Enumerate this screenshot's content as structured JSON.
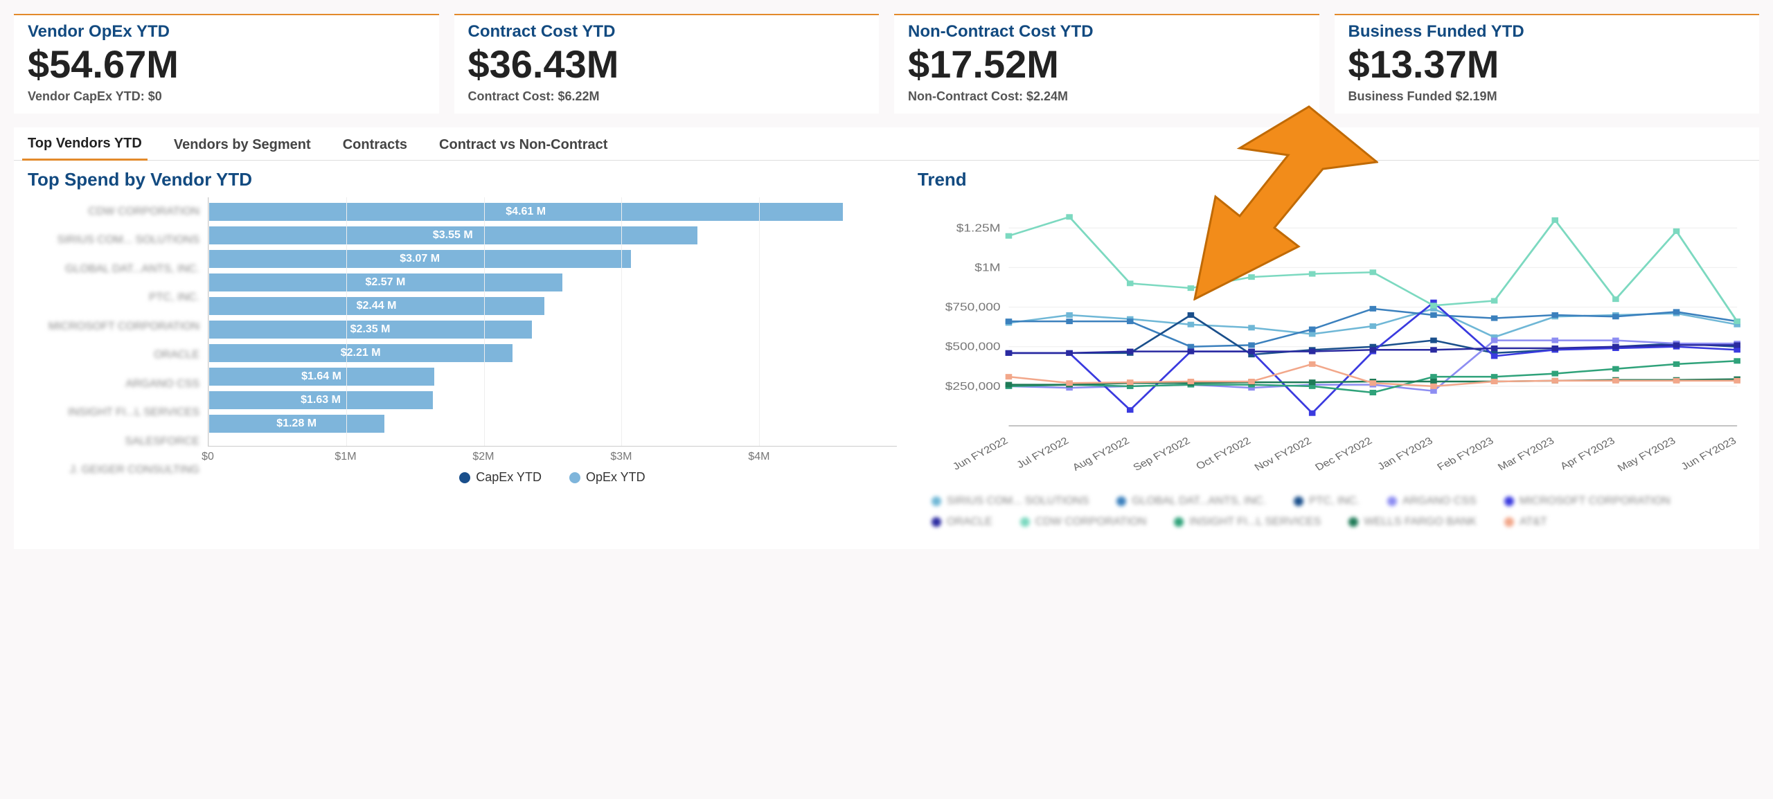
{
  "kpis": [
    {
      "title": "Vendor OpEx YTD",
      "value": "$54.67M",
      "sub": "Vendor CapEx YTD: $0"
    },
    {
      "title": "Contract Cost YTD",
      "value": "$36.43M",
      "sub": "Contract Cost: $6.22M"
    },
    {
      "title": "Non-Contract Cost YTD",
      "value": "$17.52M",
      "sub": "Non-Contract Cost: $2.24M"
    },
    {
      "title": "Business Funded YTD",
      "value": "$13.37M",
      "sub": "Business Funded $2.19M"
    }
  ],
  "tabs": [
    "Top Vendors YTD",
    "Vendors by Segment",
    "Contracts",
    "Contract vs Non-Contract"
  ],
  "active_tab": 0,
  "bar_chart_title": "Top Spend by Vendor YTD",
  "trend_title": "Trend",
  "bar_legend": {
    "capex": "CapEx YTD",
    "opex": "OpEx YTD"
  },
  "colors": {
    "opex_bar": "#7eb5db",
    "capex_dot": "#1a4f8b",
    "accent": "#e38a2b",
    "arrow": "#f28c1a"
  },
  "chart_data": [
    {
      "id": "top_spend_by_vendor",
      "type": "bar",
      "orientation": "horizontal",
      "title": "Top Spend by Vendor YTD",
      "xlabel": "",
      "ylabel": "",
      "xlim": [
        0,
        5
      ],
      "x_ticks": [
        "$0",
        "$1M",
        "$2M",
        "$3M",
        "$4M"
      ],
      "categories": [
        "CDW CORPORATION",
        "SIRIUS COM... SOLUTIONS",
        "GLOBAL DAT...ANTS, INC.",
        "PTC, INC.",
        "MICROSOFT CORPORATION",
        "ORACLE",
        "ARGANO CSS",
        "INSIGHT FI...L SERVICES",
        "SALESFORCE",
        "J. GEIGER CONSULTING"
      ],
      "values": [
        4.61,
        3.55,
        3.07,
        2.57,
        2.44,
        2.35,
        2.21,
        1.64,
        1.63,
        1.28
      ],
      "value_labels": [
        "$4.61 M",
        "$3.55 M",
        "$3.07 M",
        "$2.57 M",
        "$2.44 M",
        "$2.35 M",
        "$2.21 M",
        "$1.64 M",
        "$1.63 M",
        "$1.28 M"
      ],
      "legend": [
        "CapEx YTD",
        "OpEx YTD"
      ]
    },
    {
      "id": "trend",
      "type": "line",
      "title": "Trend",
      "x": [
        "Jun FY2022",
        "Jul FY2022",
        "Aug FY2022",
        "Sep FY2022",
        "Oct FY2022",
        "Nov FY2022",
        "Dec FY2022",
        "Jan FY2023",
        "Feb FY2023",
        "Mar FY2023",
        "Apr FY2023",
        "May FY2023",
        "Jun FY2023"
      ],
      "ylim": [
        0,
        1400000
      ],
      "y_ticks": [
        "$250,000",
        "$500,000",
        "$750,000",
        "$1M",
        "$1.25M"
      ],
      "y_tick_vals": [
        250000,
        500000,
        750000,
        1000000,
        1250000
      ],
      "series": [
        {
          "name": "SIRIUS COM... SOLUTIONS",
          "color": "#6fb7d6",
          "values": [
            650000,
            700000,
            675000,
            640000,
            620000,
            580000,
            630000,
            740000,
            560000,
            690000,
            700000,
            710000,
            640000
          ]
        },
        {
          "name": "GLOBAL DAT...ANTS, INC.",
          "color": "#3b80bd",
          "values": [
            660000,
            660000,
            660000,
            500000,
            510000,
            610000,
            740000,
            700000,
            680000,
            700000,
            690000,
            720000,
            660000
          ]
        },
        {
          "name": "PTC, INC.",
          "color": "#1a4f8b",
          "values": [
            460000,
            460000,
            460000,
            700000,
            450000,
            480000,
            500000,
            540000,
            460000,
            480000,
            500000,
            520000,
            500000
          ]
        },
        {
          "name": "ARGANO CSS",
          "color": "#8d8df2",
          "values": [
            250000,
            240000,
            250000,
            260000,
            240000,
            260000,
            260000,
            220000,
            540000,
            540000,
            540000,
            520000,
            520000
          ]
        },
        {
          "name": "MICROSOFT CORPORATION",
          "color": "#3a3adf",
          "values": [
            460000,
            460000,
            100000,
            470000,
            470000,
            80000,
            470000,
            780000,
            440000,
            480000,
            490000,
            500000,
            480000
          ]
        },
        {
          "name": "ORACLE",
          "color": "#2a2aa0",
          "values": [
            460000,
            460000,
            470000,
            470000,
            470000,
            470000,
            480000,
            480000,
            490000,
            490000,
            500000,
            510000,
            510000
          ]
        },
        {
          "name": "CDW CORPORATION",
          "color": "#7cd9c0",
          "values": [
            1200000,
            1320000,
            900000,
            870000,
            940000,
            960000,
            970000,
            760000,
            790000,
            1300000,
            800000,
            1230000,
            660000
          ]
        },
        {
          "name": "INSIGHT FI...L SERVICES",
          "color": "#2fa27a",
          "values": [
            250000,
            260000,
            250000,
            260000,
            260000,
            250000,
            210000,
            310000,
            310000,
            330000,
            360000,
            390000,
            410000
          ]
        },
        {
          "name": "WELLS FARGO BANK",
          "color": "#1e7a57",
          "values": [
            260000,
            260000,
            270000,
            270000,
            275000,
            275000,
            280000,
            280000,
            280000,
            285000,
            290000,
            290000,
            295000
          ]
        },
        {
          "name": "AT&T",
          "color": "#f2a78a",
          "values": [
            310000,
            270000,
            275000,
            280000,
            280000,
            390000,
            270000,
            250000,
            280000,
            285000,
            285000,
            285000,
            285000
          ]
        }
      ]
    }
  ]
}
